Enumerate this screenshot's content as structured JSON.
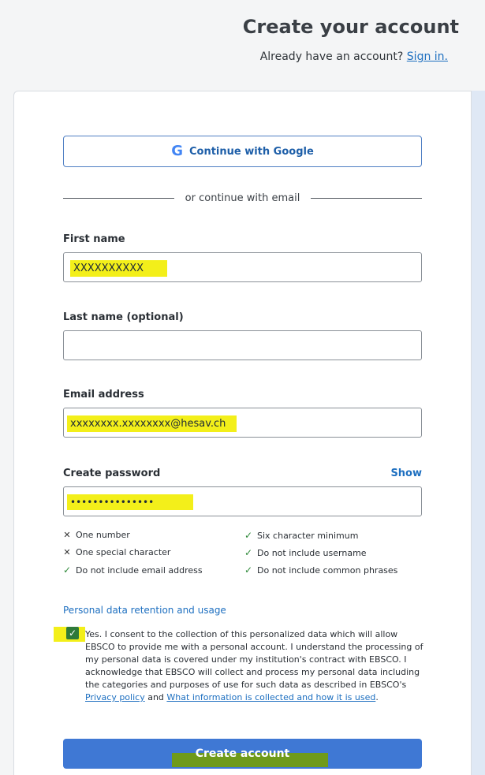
{
  "header": {
    "title": "Create your account",
    "signin_prompt": "Already have an account?",
    "signin_link": "Sign in."
  },
  "social": {
    "google_label": "Continue with Google",
    "google_icon": "G"
  },
  "divider_text": "or continue with email",
  "fields": {
    "first_name": {
      "label": "First name",
      "value": "XXXXXXXXXX"
    },
    "last_name": {
      "label": "Last name (optional)",
      "value": ""
    },
    "email": {
      "label": "Email address",
      "value": "xxxxxxxx.xxxxxxxx@hesav.ch"
    },
    "password": {
      "label": "Create password",
      "value": "•••••••••••••••",
      "show_label": "Show"
    }
  },
  "requirements": [
    {
      "text": "One number",
      "met": false
    },
    {
      "text": "Six character minimum",
      "met": true
    },
    {
      "text": "One special character",
      "met": false
    },
    {
      "text": "Do not include username",
      "met": true
    },
    {
      "text": "Do not include email address",
      "met": true
    },
    {
      "text": "Do not include common phrases",
      "met": true
    }
  ],
  "requirement_marks": {
    "met": "✓",
    "unmet": "✕"
  },
  "consent": {
    "section_link": "Personal data retention and usage",
    "checked": true,
    "check_glyph": "✓",
    "text_main": "Yes. I consent to the collection of this personalized data which will allow EBSCO to provide me with a personal account. I understand the processing of my personal data is covered under my institution's contract with EBSCO. I acknowledge that EBSCO will collect and process my personal data including the categories and purposes of use for such data as described in EBSCO's",
    "privacy_link": "Privacy policy",
    "and_text": "and",
    "info_link": "What information is collected and how it is used",
    "end_text": "."
  },
  "submit_label": "Create account",
  "colors": {
    "accent": "#1d6fc0",
    "button": "#3f78d4",
    "check_ok": "#2f8a3a",
    "highlight": "#f3ef1a"
  }
}
